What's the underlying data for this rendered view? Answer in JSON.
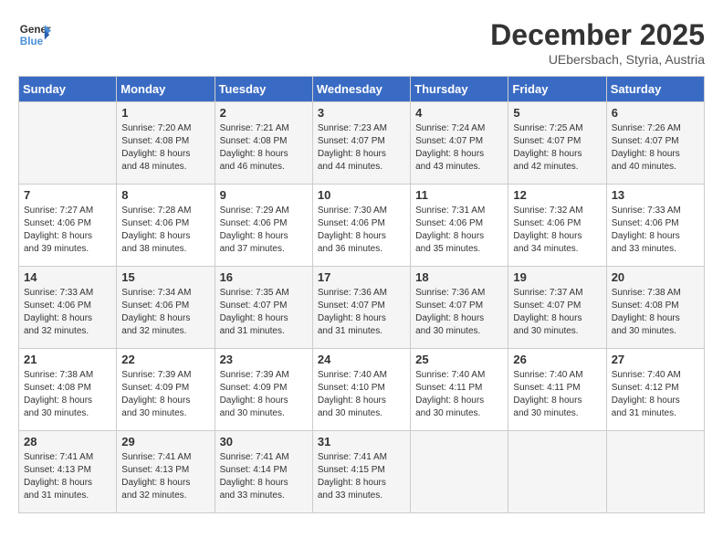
{
  "header": {
    "logo_line1": "General",
    "logo_line2": "Blue",
    "month_year": "December 2025",
    "location": "UEbersbach, Styria, Austria"
  },
  "weekdays": [
    "Sunday",
    "Monday",
    "Tuesday",
    "Wednesday",
    "Thursday",
    "Friday",
    "Saturday"
  ],
  "weeks": [
    [
      {
        "day": "",
        "info": ""
      },
      {
        "day": "1",
        "info": "Sunrise: 7:20 AM\nSunset: 4:08 PM\nDaylight: 8 hours\nand 48 minutes."
      },
      {
        "day": "2",
        "info": "Sunrise: 7:21 AM\nSunset: 4:08 PM\nDaylight: 8 hours\nand 46 minutes."
      },
      {
        "day": "3",
        "info": "Sunrise: 7:23 AM\nSunset: 4:07 PM\nDaylight: 8 hours\nand 44 minutes."
      },
      {
        "day": "4",
        "info": "Sunrise: 7:24 AM\nSunset: 4:07 PM\nDaylight: 8 hours\nand 43 minutes."
      },
      {
        "day": "5",
        "info": "Sunrise: 7:25 AM\nSunset: 4:07 PM\nDaylight: 8 hours\nand 42 minutes."
      },
      {
        "day": "6",
        "info": "Sunrise: 7:26 AM\nSunset: 4:07 PM\nDaylight: 8 hours\nand 40 minutes."
      }
    ],
    [
      {
        "day": "7",
        "info": "Sunrise: 7:27 AM\nSunset: 4:06 PM\nDaylight: 8 hours\nand 39 minutes."
      },
      {
        "day": "8",
        "info": "Sunrise: 7:28 AM\nSunset: 4:06 PM\nDaylight: 8 hours\nand 38 minutes."
      },
      {
        "day": "9",
        "info": "Sunrise: 7:29 AM\nSunset: 4:06 PM\nDaylight: 8 hours\nand 37 minutes."
      },
      {
        "day": "10",
        "info": "Sunrise: 7:30 AM\nSunset: 4:06 PM\nDaylight: 8 hours\nand 36 minutes."
      },
      {
        "day": "11",
        "info": "Sunrise: 7:31 AM\nSunset: 4:06 PM\nDaylight: 8 hours\nand 35 minutes."
      },
      {
        "day": "12",
        "info": "Sunrise: 7:32 AM\nSunset: 4:06 PM\nDaylight: 8 hours\nand 34 minutes."
      },
      {
        "day": "13",
        "info": "Sunrise: 7:33 AM\nSunset: 4:06 PM\nDaylight: 8 hours\nand 33 minutes."
      }
    ],
    [
      {
        "day": "14",
        "info": "Sunrise: 7:33 AM\nSunset: 4:06 PM\nDaylight: 8 hours\nand 32 minutes."
      },
      {
        "day": "15",
        "info": "Sunrise: 7:34 AM\nSunset: 4:06 PM\nDaylight: 8 hours\nand 32 minutes."
      },
      {
        "day": "16",
        "info": "Sunrise: 7:35 AM\nSunset: 4:07 PM\nDaylight: 8 hours\nand 31 minutes."
      },
      {
        "day": "17",
        "info": "Sunrise: 7:36 AM\nSunset: 4:07 PM\nDaylight: 8 hours\nand 31 minutes."
      },
      {
        "day": "18",
        "info": "Sunrise: 7:36 AM\nSunset: 4:07 PM\nDaylight: 8 hours\nand 30 minutes."
      },
      {
        "day": "19",
        "info": "Sunrise: 7:37 AM\nSunset: 4:07 PM\nDaylight: 8 hours\nand 30 minutes."
      },
      {
        "day": "20",
        "info": "Sunrise: 7:38 AM\nSunset: 4:08 PM\nDaylight: 8 hours\nand 30 minutes."
      }
    ],
    [
      {
        "day": "21",
        "info": "Sunrise: 7:38 AM\nSunset: 4:08 PM\nDaylight: 8 hours\nand 30 minutes."
      },
      {
        "day": "22",
        "info": "Sunrise: 7:39 AM\nSunset: 4:09 PM\nDaylight: 8 hours\nand 30 minutes."
      },
      {
        "day": "23",
        "info": "Sunrise: 7:39 AM\nSunset: 4:09 PM\nDaylight: 8 hours\nand 30 minutes."
      },
      {
        "day": "24",
        "info": "Sunrise: 7:40 AM\nSunset: 4:10 PM\nDaylight: 8 hours\nand 30 minutes."
      },
      {
        "day": "25",
        "info": "Sunrise: 7:40 AM\nSunset: 4:11 PM\nDaylight: 8 hours\nand 30 minutes."
      },
      {
        "day": "26",
        "info": "Sunrise: 7:40 AM\nSunset: 4:11 PM\nDaylight: 8 hours\nand 30 minutes."
      },
      {
        "day": "27",
        "info": "Sunrise: 7:40 AM\nSunset: 4:12 PM\nDaylight: 8 hours\nand 31 minutes."
      }
    ],
    [
      {
        "day": "28",
        "info": "Sunrise: 7:41 AM\nSunset: 4:13 PM\nDaylight: 8 hours\nand 31 minutes."
      },
      {
        "day": "29",
        "info": "Sunrise: 7:41 AM\nSunset: 4:13 PM\nDaylight: 8 hours\nand 32 minutes."
      },
      {
        "day": "30",
        "info": "Sunrise: 7:41 AM\nSunset: 4:14 PM\nDaylight: 8 hours\nand 33 minutes."
      },
      {
        "day": "31",
        "info": "Sunrise: 7:41 AM\nSunset: 4:15 PM\nDaylight: 8 hours\nand 33 minutes."
      },
      {
        "day": "",
        "info": ""
      },
      {
        "day": "",
        "info": ""
      },
      {
        "day": "",
        "info": ""
      }
    ]
  ]
}
